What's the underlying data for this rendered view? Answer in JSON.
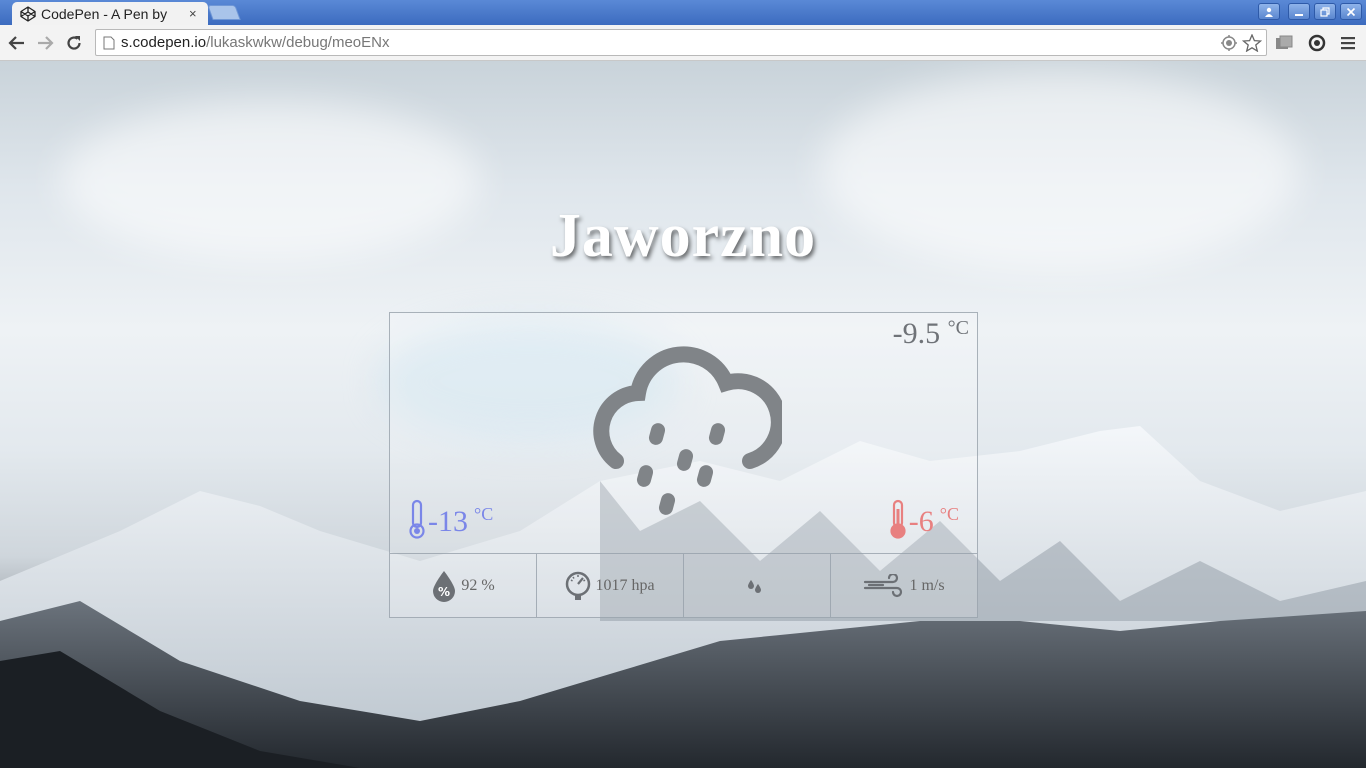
{
  "browser": {
    "tab_title": "CodePen - A Pen by",
    "tab_close": "×",
    "url_host": "s.codepen.io",
    "url_path": "/lukaskwkw/debug/meoENx"
  },
  "weather": {
    "city": "Jaworzno",
    "current_temp": "-9.5",
    "unit": "°C",
    "min_temp": "-13",
    "max_temp": "-6",
    "humidity": "92 %",
    "pressure": "1017 hpa",
    "wind": "1 m/s",
    "condition_icon": "cloud-rain-icon"
  },
  "colors": {
    "min_temp": "#7a86e8",
    "max_temp": "#e88080",
    "icon_gray": "#808488"
  }
}
